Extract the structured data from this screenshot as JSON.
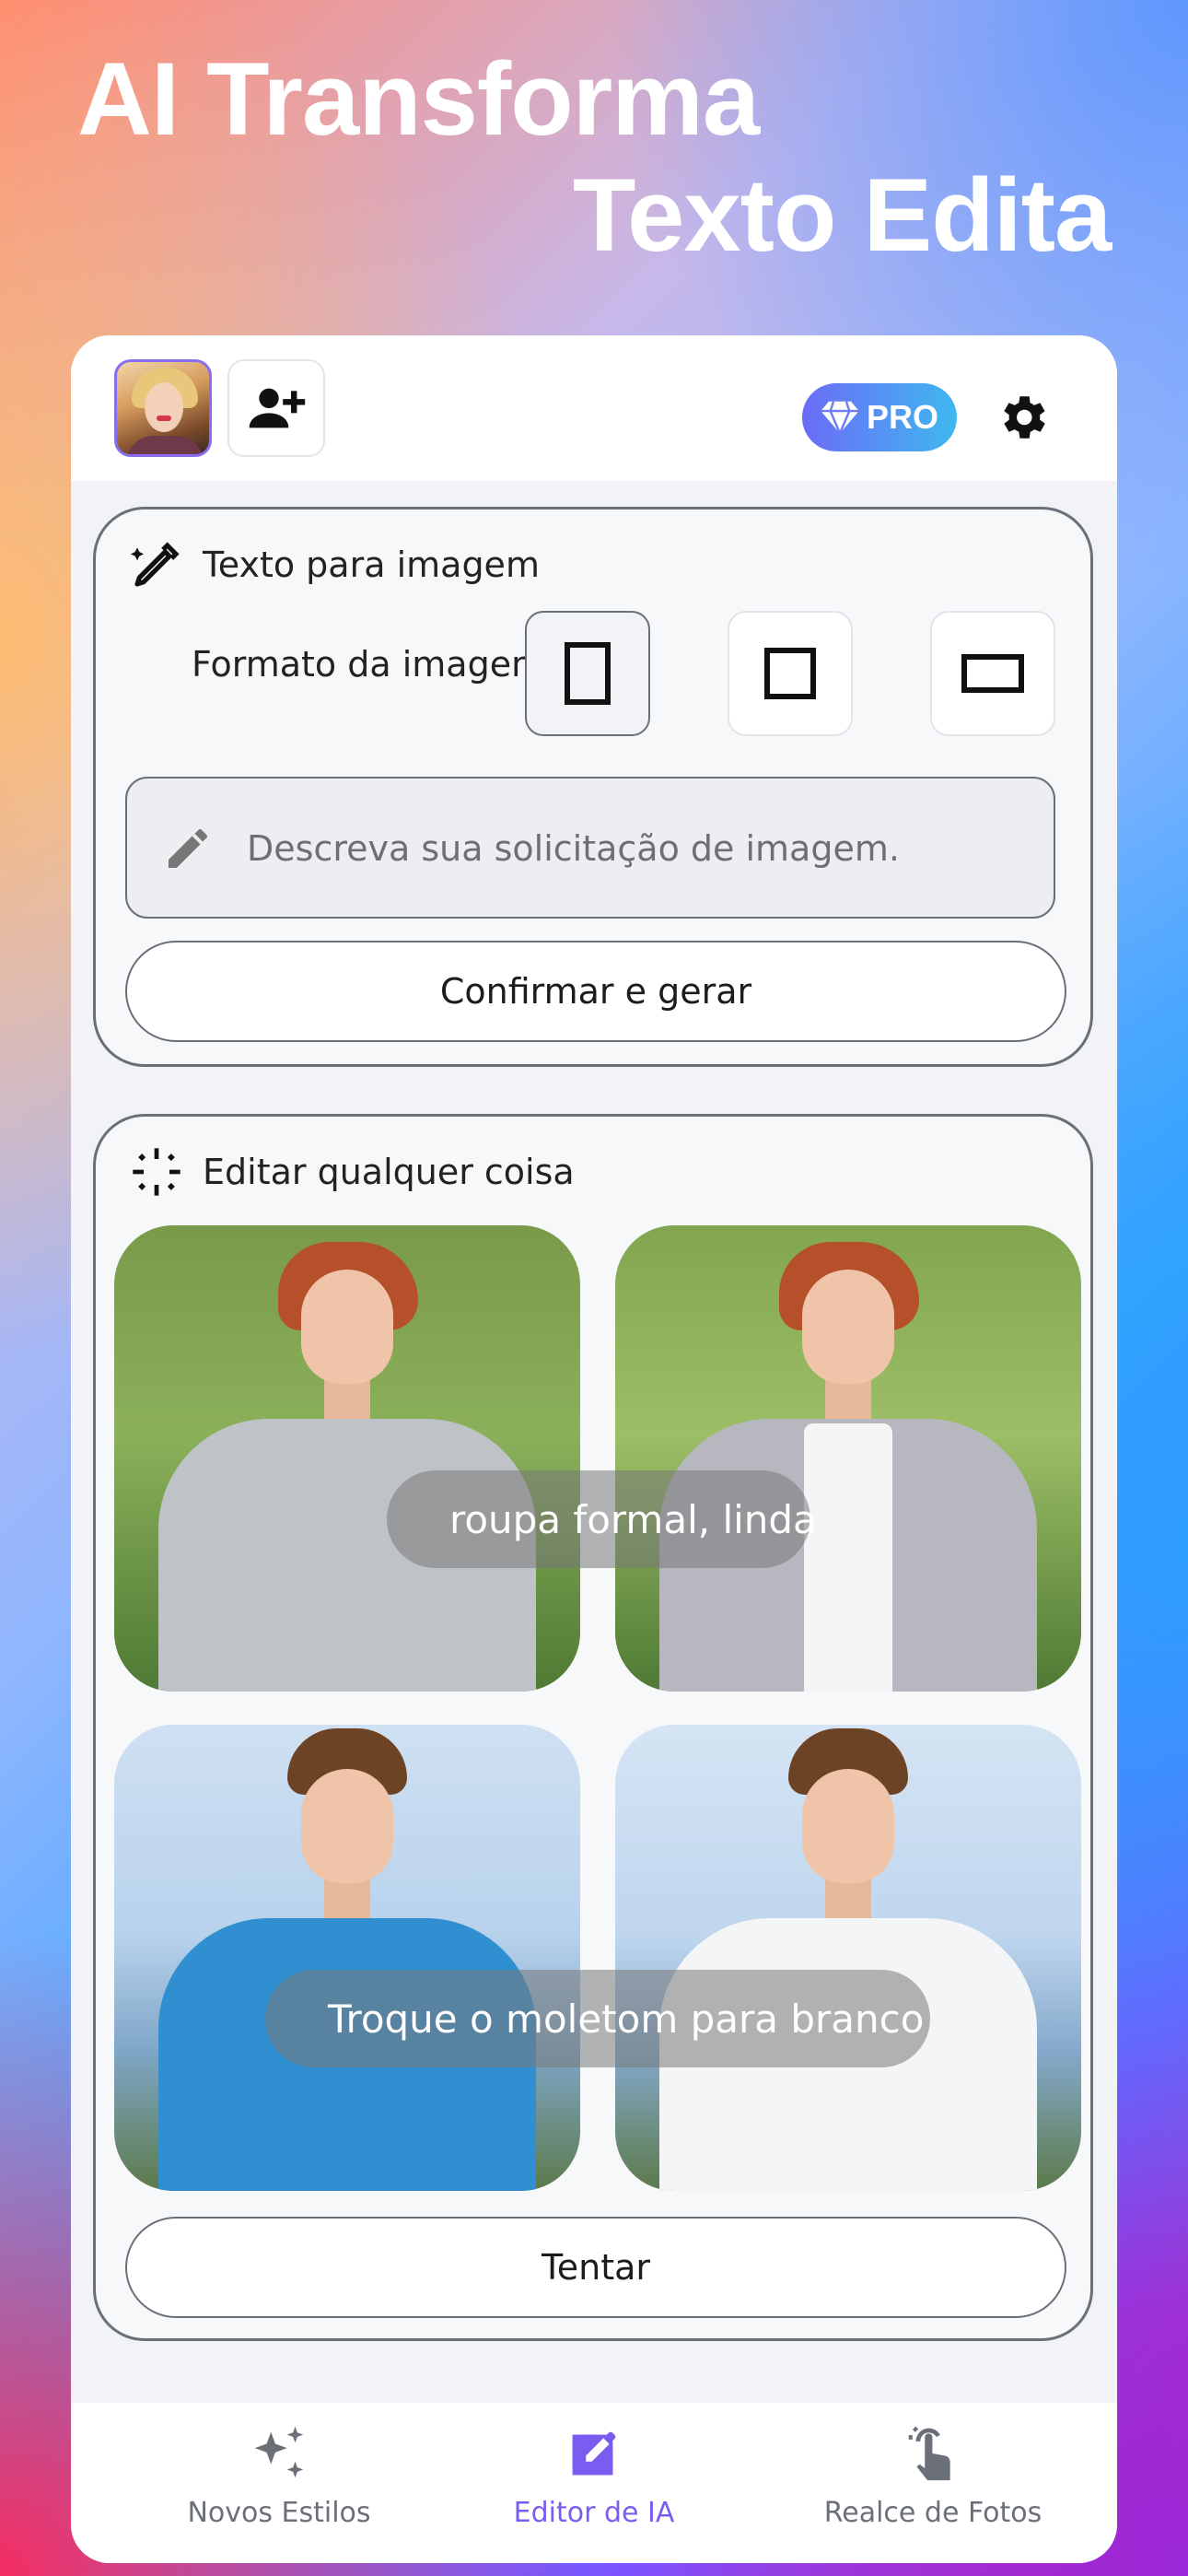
{
  "headline": {
    "line1": "AI Transforma",
    "line2": "Texto Edita"
  },
  "topbar": {
    "pro_label": "PRO"
  },
  "text_to_image": {
    "title": "Texto para imagem",
    "format_label": "Formato da imagem",
    "prompt_placeholder": "Descreva sua solicitação de imagem.",
    "confirm_label": "Confirmar e gerar"
  },
  "edit_anything": {
    "title": "Editar qualquer coisa",
    "example1_prompt": "roupa formal, linda",
    "example2_prompt": "Troque o moletom para branco",
    "try_label": "Tentar"
  },
  "bottom_nav": {
    "items": [
      {
        "label": "Novos Estilos",
        "icon": "sparkles-icon"
      },
      {
        "label": "Editor de IA",
        "icon": "edit-square-icon",
        "active": true
      },
      {
        "label": "Realce de Fotos",
        "icon": "tap-hand-icon"
      }
    ]
  },
  "colors": {
    "accent": "#7b5cf0",
    "pro_gradient_start": "#6b6cf6",
    "pro_gradient_end": "#3fb8f0"
  }
}
